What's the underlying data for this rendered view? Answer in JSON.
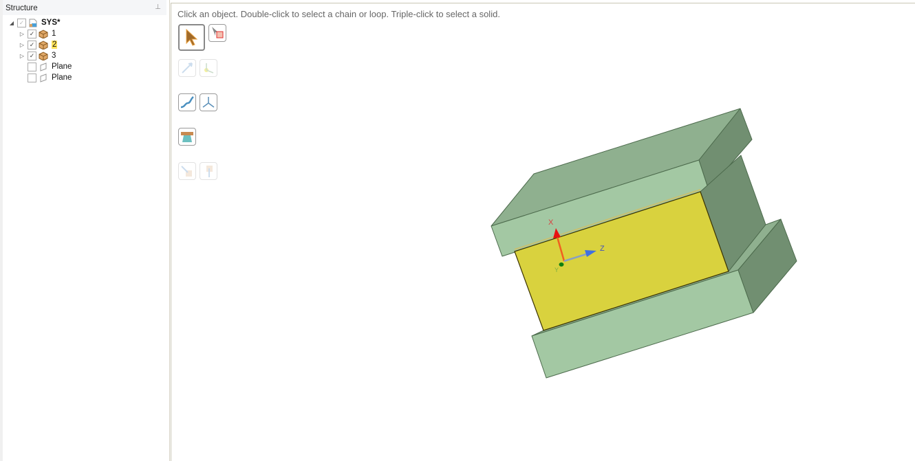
{
  "structure": {
    "title": "Structure",
    "pin_icon": "pin-icon",
    "root": {
      "label": "SYS*"
    },
    "items": [
      {
        "label": "1",
        "checked": true
      },
      {
        "label": "2",
        "checked": true,
        "highlighted": true
      },
      {
        "label": "3",
        "checked": true
      }
    ],
    "planes": [
      {
        "label": "Plane",
        "checked": false
      },
      {
        "label": "Plane",
        "checked": false
      }
    ]
  },
  "viewport": {
    "hint": "Click an object.  Double-click to select a chain or loop.  Triple-click to select a solid.",
    "triad": {
      "x": "X",
      "y": "Y",
      "z": "Z"
    },
    "colors": {
      "block": "#a3c8a3",
      "block_top": "#8fb08f",
      "block_side": "#718f71",
      "selected": "#d9d23e"
    }
  }
}
